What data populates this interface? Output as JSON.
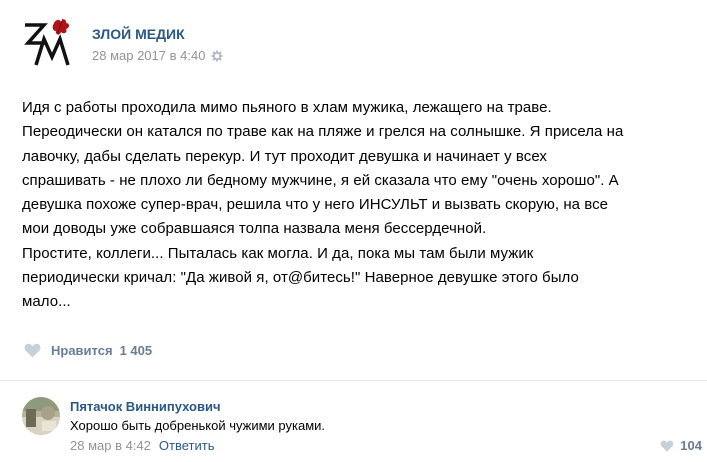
{
  "post": {
    "author": "ЗЛОЙ МЕДИК",
    "date": "28 мар 2017 в 4:40",
    "lines": [
      "Идя с работы проходила мимо пьяного в хлам мужика, лежащего на траве.",
      "Переодически он катался по траве как на пляже и грелся на солнышке. Я присела на",
      "лавочку, дабы сделать перекур. И тут проходит девушка и начинает у всех",
      "спрашивать - не плохо ли бедному мужчине, я ей сказала что ему \"очень хорошо\". А",
      "девушка похоже супер-врач, решила что у него ИНСУЛЬТ и вызвать скорую, на все",
      "мои доводы уже собравшаяся толпа назвала меня бессердечной.",
      "Простите, коллеги... Пыталась как могла. И да, пока мы там были мужик",
      "периодически кричал: \"Да живой я, от@битесь!\" Наверное девушке этого было",
      "мало..."
    ],
    "likes_label": "Нравится",
    "likes_count": "1 405",
    "logo_text": "ЗМ"
  },
  "comment": {
    "author": "Пятачок Виннипухович",
    "text": "Хорошо быть добренькой чужими руками.",
    "date": "28 мар в 4:42",
    "reply_label": "Ответить",
    "likes_count": "104"
  },
  "icons": {
    "settings": "gear-icon",
    "like": "heart-icon"
  },
  "colors": {
    "link": "#2a5885",
    "meta": "#939393",
    "like_gray": "#c5d0db",
    "logo_red": "#b01318"
  }
}
